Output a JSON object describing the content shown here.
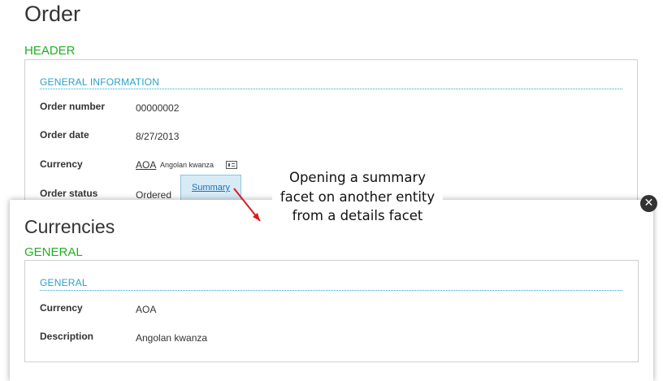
{
  "order": {
    "title": "Order",
    "section_label": "HEADER",
    "group_title": "GENERAL INFORMATION",
    "fields": [
      {
        "label": "Order number",
        "value": "00000002"
      },
      {
        "label": "Order date",
        "value": "8/27/2013"
      },
      {
        "label": "Currency",
        "code": "AOA",
        "name": "Angolan kwanza"
      },
      {
        "label": "Order status",
        "value": "Ordered"
      }
    ],
    "summary_link": "Summary"
  },
  "annotation": {
    "text": "Opening a summary facet on another entity from a details facet",
    "arrow_color": "#e0191f"
  },
  "summary": {
    "title": "Currencies",
    "section_label": "GENERAL",
    "group_title": "GENERAL",
    "fields": [
      {
        "label": "Currency",
        "value": "AOA"
      },
      {
        "label": "Description",
        "value": "Angolan kwanza"
      }
    ],
    "close_icon": "close-icon"
  },
  "colors": {
    "section_green": "#21b021",
    "group_blue": "#2aa1c9",
    "link_blue": "#1f6fb5",
    "tip_background": "#d7ebf6"
  }
}
